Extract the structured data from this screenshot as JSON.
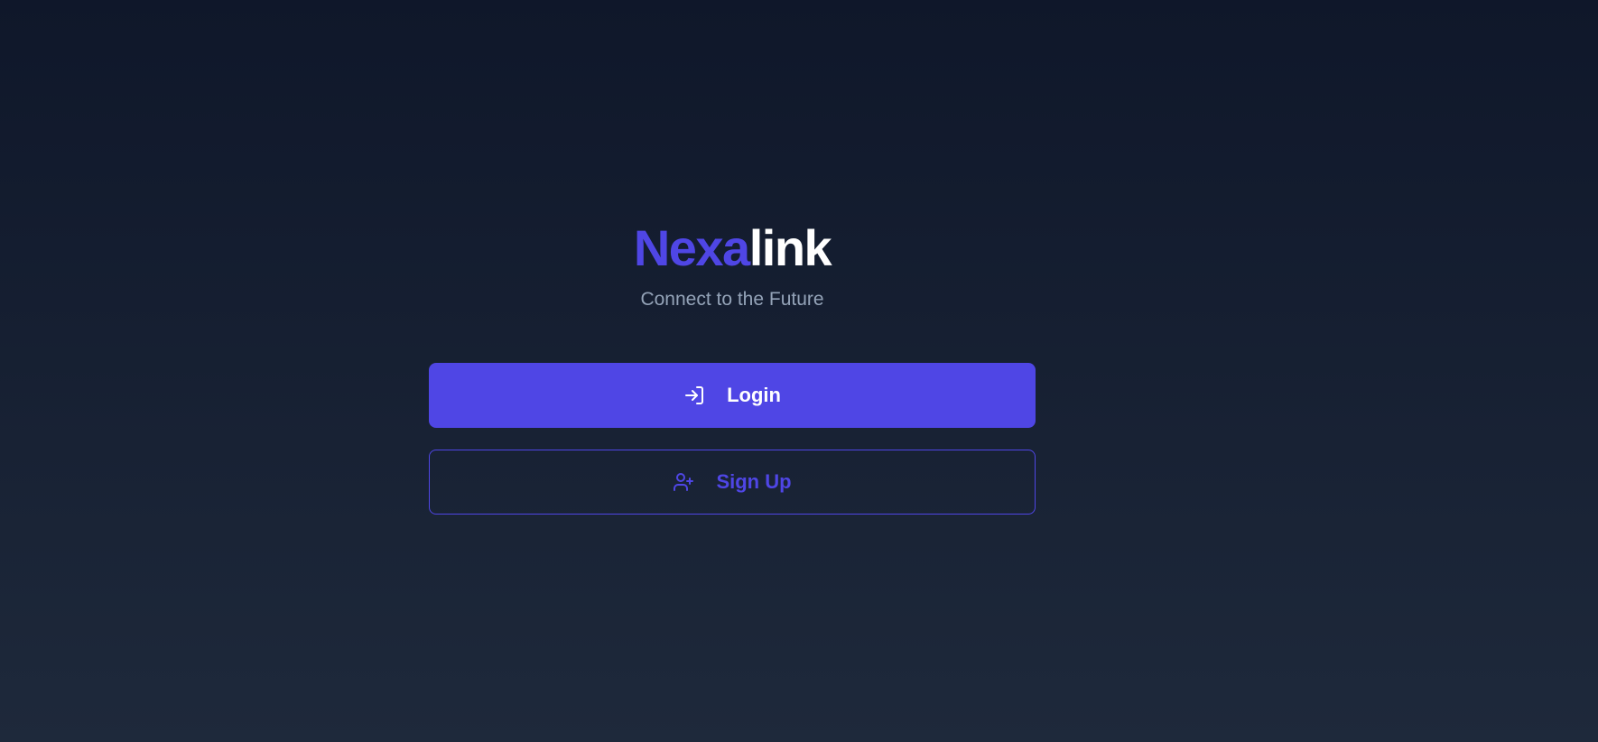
{
  "brand": {
    "primary": "Nexa",
    "secondary": "link",
    "tagline": "Connect to the Future"
  },
  "actions": {
    "login": {
      "label": "Login",
      "icon": "login-icon"
    },
    "signup": {
      "label": "Sign Up",
      "icon": "user-plus-icon"
    }
  },
  "colors": {
    "accent": "#4f46e5",
    "background_top": "#0f172a",
    "background_bottom": "#1e293b",
    "tagline": "#94a3b8"
  }
}
